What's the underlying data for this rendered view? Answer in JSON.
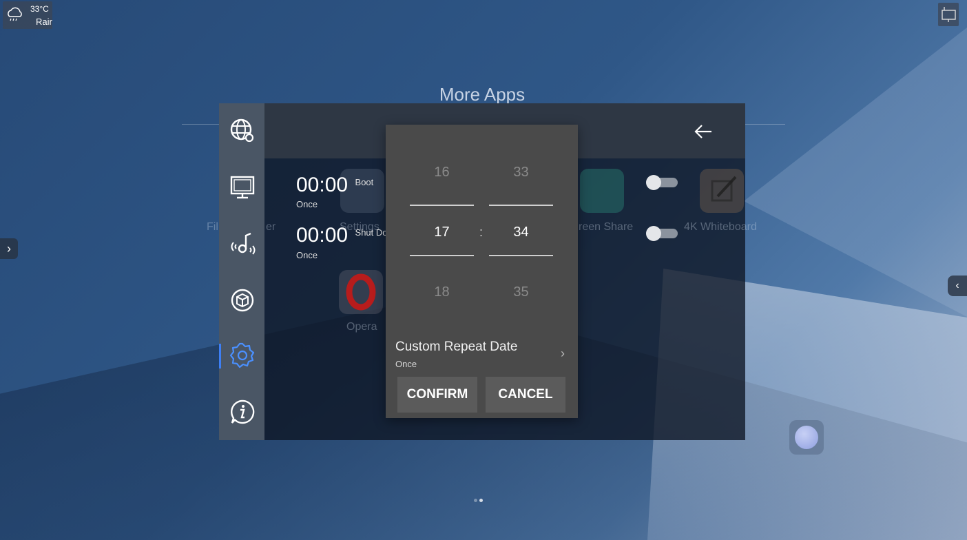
{
  "weather": {
    "temp": "33°C",
    "condition": "Rair"
  },
  "background_title": "More Apps",
  "schedule": [
    {
      "time": "00:00",
      "type": "Boot",
      "repeat": "Once"
    },
    {
      "time": "00:00",
      "type": "Shut Do",
      "repeat": "Once"
    }
  ],
  "background_apps": {
    "file_manager": "Fil",
    "file_manager_tail": "er",
    "settings": "Settings",
    "screen_share": "reen Share",
    "whiteboard": "4K Whiteboard",
    "opera": "Opera"
  },
  "toggles": [
    {
      "state": "off"
    },
    {
      "state": "off"
    }
  ],
  "side_nav": [
    "network-settings-icon",
    "display-icon",
    "audio-icon",
    "apps-icon",
    "settings-icon",
    "info-icon"
  ],
  "picker": {
    "hours": {
      "prev": "16",
      "selected": "17",
      "next": "18"
    },
    "minutes": {
      "prev": "33",
      "selected": "34",
      "next": "35"
    },
    "separator": ":",
    "repeat_title": "Custom Repeat Date",
    "repeat_value": "Once",
    "confirm": "CONFIRM",
    "cancel": "CANCEL"
  },
  "edge_left": "›",
  "edge_right": "‹",
  "colors": {
    "accent": "#3d7ff5",
    "picker_bg": "#4a4a4a",
    "button_bg": "#5b5b5b"
  }
}
